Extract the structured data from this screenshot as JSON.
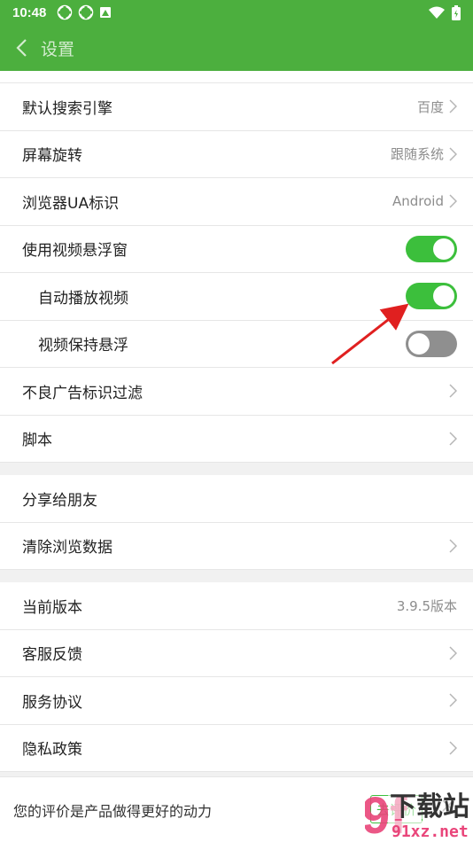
{
  "status": {
    "time": "10:48"
  },
  "appbar": {
    "title": "设置"
  },
  "sections": {
    "browser": [
      {
        "label": "默认搜索引擎",
        "value": "百度"
      },
      {
        "label": "屏幕旋转",
        "value": "跟随系统"
      },
      {
        "label": "浏览器UA标识",
        "value": "Android"
      },
      {
        "label": "使用视频悬浮窗",
        "toggle": true
      },
      {
        "label": "自动播放视频",
        "toggle": true
      },
      {
        "label": "视频保持悬浮",
        "toggle": false
      },
      {
        "label": "不良广告标识过滤"
      },
      {
        "label": "脚本"
      }
    ],
    "data": [
      {
        "label": "分享给朋友"
      },
      {
        "label": "清除浏览数据"
      }
    ],
    "about": [
      {
        "label": "当前版本",
        "value": "3.9.5版本"
      },
      {
        "label": "客服反馈"
      },
      {
        "label": "服务协议"
      },
      {
        "label": "隐私政策"
      }
    ]
  },
  "rating": {
    "message": "您的评价是产品做得更好的动力",
    "button": "去评价"
  },
  "watermark": {
    "text": "下载站",
    "domain": "91xz.net",
    "logo": "9f"
  },
  "colors": {
    "accent": "#4caf3e",
    "toggle_on": "#3cbf3c",
    "arrow": "#e02020"
  }
}
